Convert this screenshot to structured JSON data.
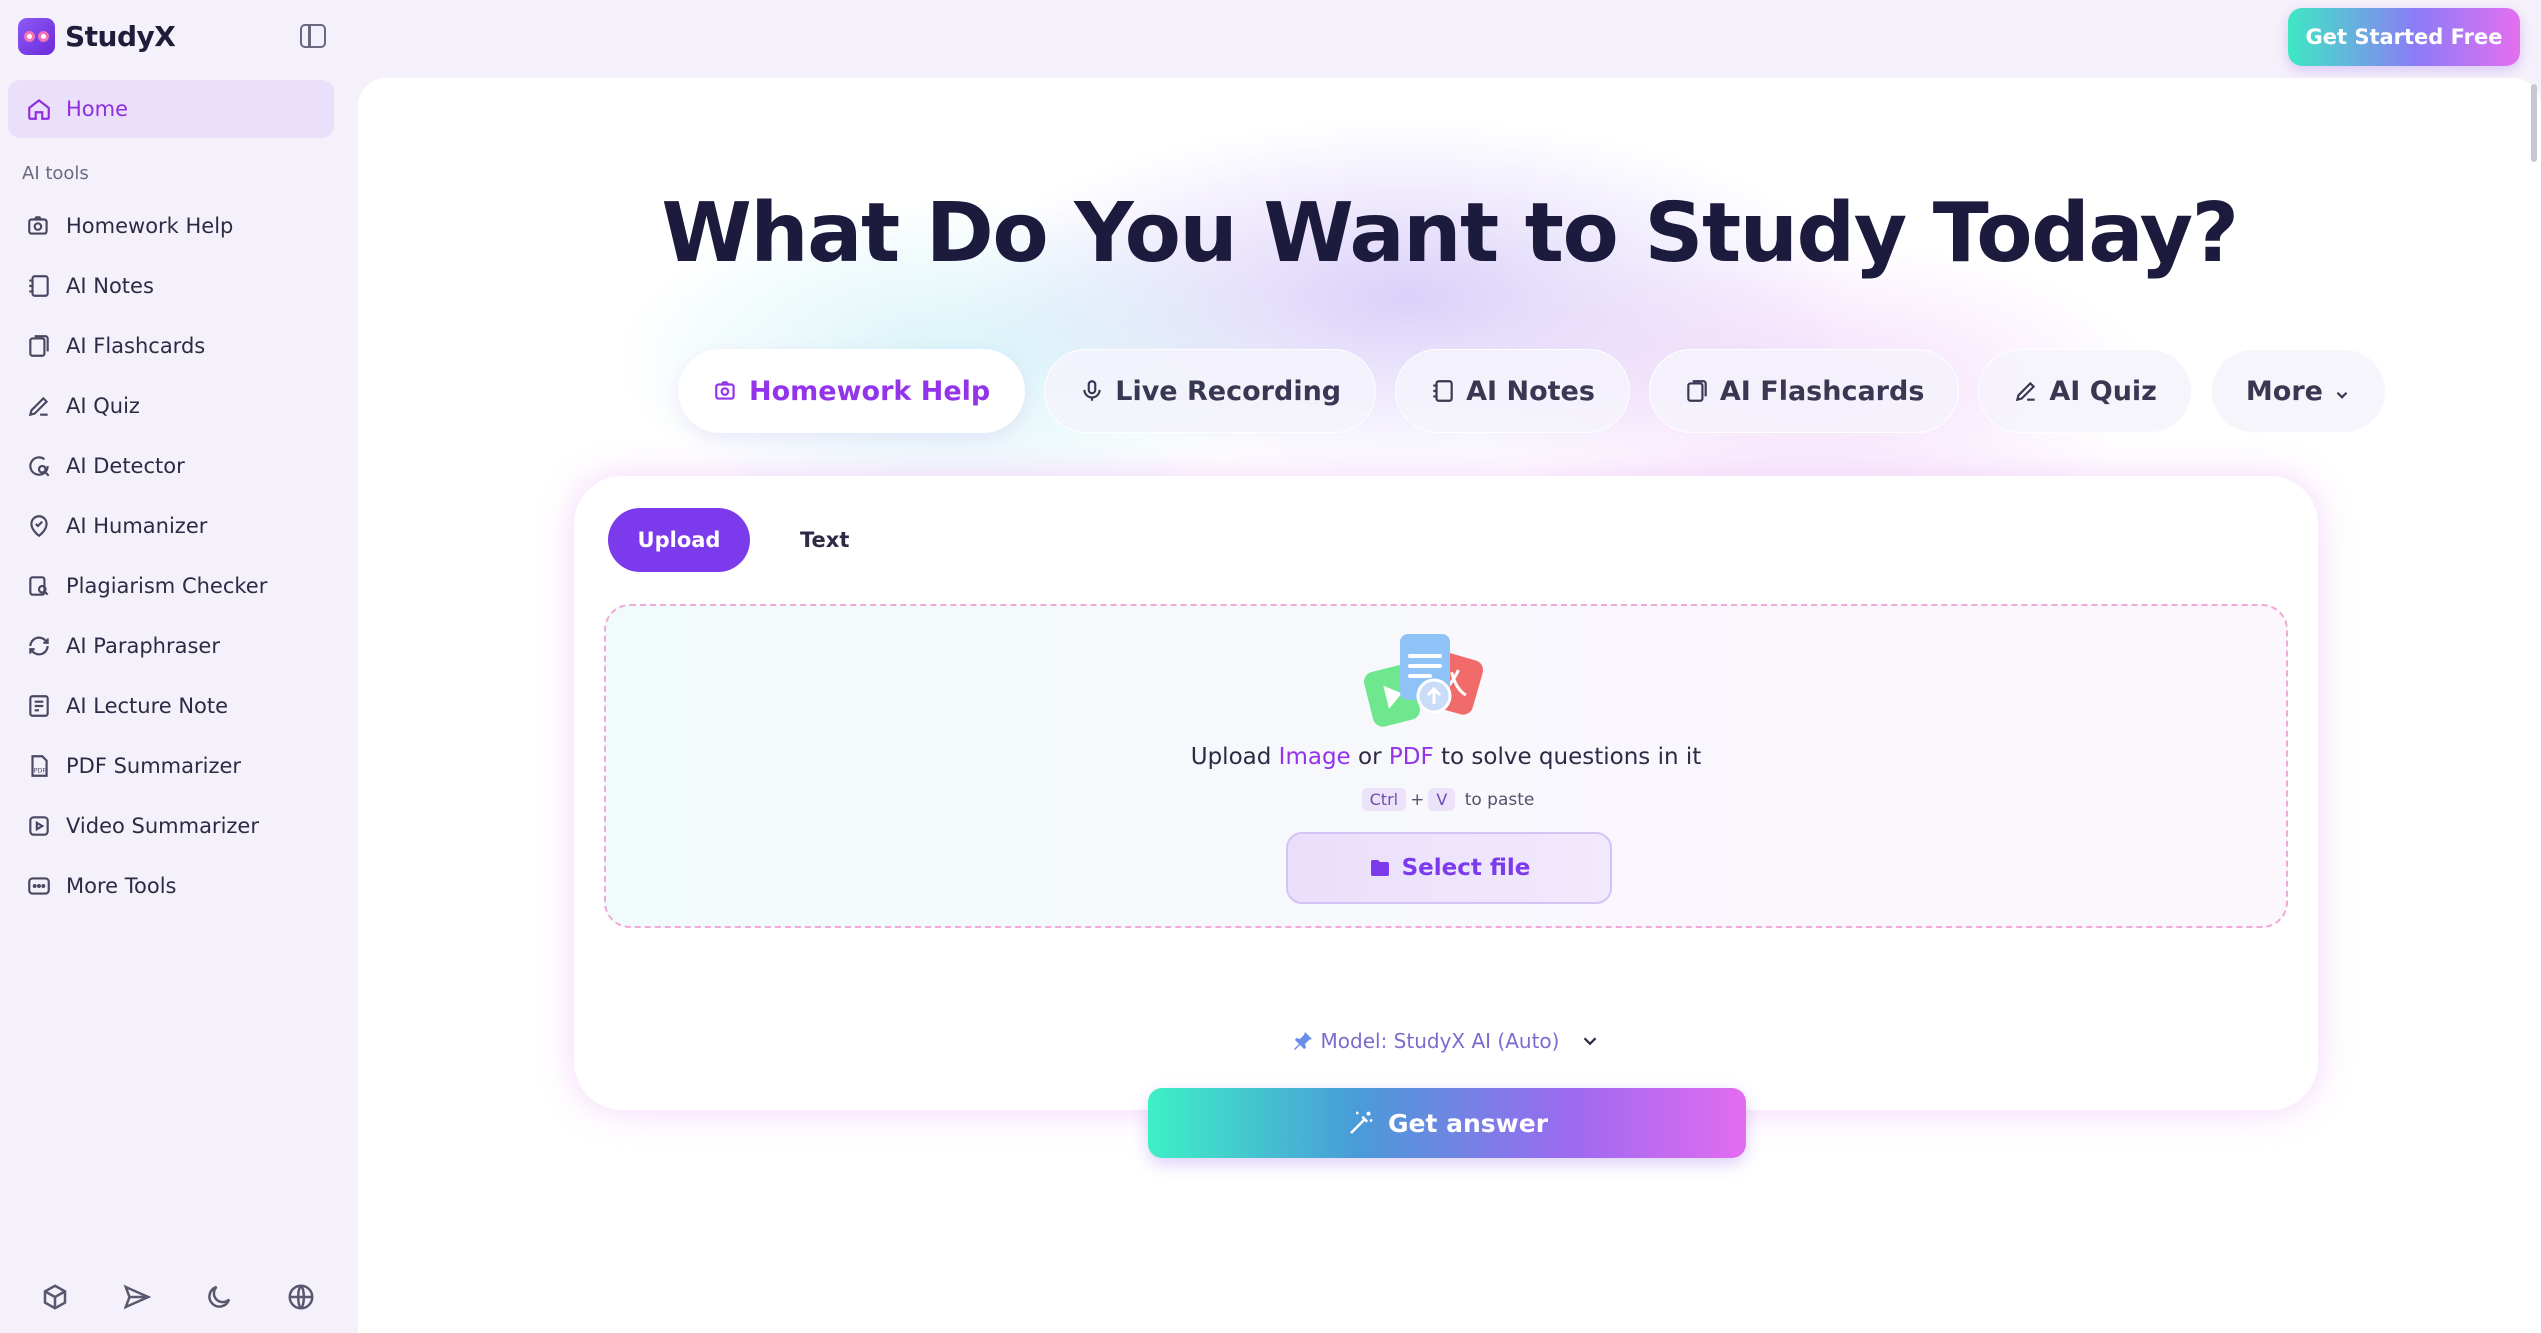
{
  "brand": {
    "name": "StudyX"
  },
  "header": {
    "cta_label": "Get Started Free"
  },
  "sidebar": {
    "home_label": "Home",
    "section_label": "AI tools",
    "items": [
      {
        "label": "Homework Help",
        "icon": "camera-search-icon"
      },
      {
        "label": "AI Notes",
        "icon": "notebook-icon"
      },
      {
        "label": "AI Flashcards",
        "icon": "flashcards-icon"
      },
      {
        "label": "AI Quiz",
        "icon": "pencil-quiz-icon"
      },
      {
        "label": "AI Detector",
        "icon": "detector-icon"
      },
      {
        "label": "AI Humanizer",
        "icon": "humanizer-icon"
      },
      {
        "label": "Plagiarism Checker",
        "icon": "plagiarism-icon"
      },
      {
        "label": "AI Paraphraser",
        "icon": "paraphrase-icon"
      },
      {
        "label": "AI Lecture Note",
        "icon": "lecture-note-icon"
      },
      {
        "label": "PDF Summarizer",
        "icon": "pdf-icon"
      },
      {
        "label": "Video Summarizer",
        "icon": "video-icon"
      },
      {
        "label": "More Tools",
        "icon": "more-tools-icon"
      }
    ],
    "footer_icons": [
      "cube-icon",
      "send-icon",
      "moon-icon",
      "globe-icon"
    ]
  },
  "main": {
    "headline": "What Do You Want to Study Today?",
    "tabs": [
      {
        "label": "Homework Help",
        "active": true
      },
      {
        "label": "Live Recording",
        "active": false
      },
      {
        "label": "AI Notes",
        "active": false
      },
      {
        "label": "AI Flashcards",
        "active": false
      },
      {
        "label": "AI Quiz",
        "active": false
      },
      {
        "label": "More",
        "active": false
      }
    ],
    "input_modes": {
      "upload": "Upload",
      "text": "Text"
    },
    "dropzone": {
      "prefix": "Upload ",
      "image": "Image",
      "or": " or ",
      "pdf": "PDF",
      "suffix": " to solve questions in it",
      "key_ctrl": "Ctrl",
      "plus": "+",
      "key_v": "V",
      "paste_suffix": "to paste",
      "select_file": "Select file"
    },
    "model_label": "Model: StudyX AI (Auto)",
    "get_answer": "Get answer"
  },
  "colors": {
    "accent": "#9333ea",
    "primary_button": "#7c3aed"
  }
}
